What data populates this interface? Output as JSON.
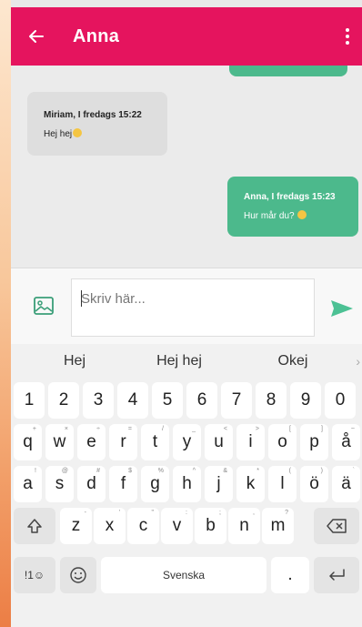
{
  "header": {
    "title": "Anna"
  },
  "messages": [
    {
      "meta": "Miriam, I fredags 15:22",
      "text": "Hej hej"
    },
    {
      "meta": "Anna, I fredags 15:23",
      "text": "Hur mår du?"
    }
  ],
  "composer": {
    "placeholder": "Skriv här..."
  },
  "keyboard": {
    "suggestions": [
      "Hej",
      "Hej hej",
      "Okej"
    ],
    "row1": [
      "1",
      "2",
      "3",
      "4",
      "5",
      "6",
      "7",
      "8",
      "9",
      "0"
    ],
    "row2": [
      "q",
      "w",
      "e",
      "r",
      "t",
      "y",
      "u",
      "i",
      "o",
      "p",
      "å"
    ],
    "row2_hints": [
      "+",
      "×",
      "÷",
      "=",
      "/",
      "_",
      "<",
      ">",
      "[",
      "]",
      "~"
    ],
    "row3": [
      "a",
      "s",
      "d",
      "f",
      "g",
      "h",
      "j",
      "k",
      "l",
      "ö",
      "ä"
    ],
    "row3_hints": [
      "!",
      "@",
      "#",
      "$",
      "%",
      "^",
      "&",
      "*",
      "(",
      ")",
      "`"
    ],
    "row4": [
      "z",
      "x",
      "c",
      "v",
      "b",
      "n",
      "m"
    ],
    "row4_hints": [
      "-",
      "'",
      "\"",
      ":",
      ";",
      ",",
      "?"
    ],
    "symbols_label": "!1☺",
    "space_label": "Svenska",
    "period_label": "."
  },
  "colors": {
    "brand": "#e5145e",
    "outgoing": "#4cb98c",
    "incoming": "#dedede"
  }
}
